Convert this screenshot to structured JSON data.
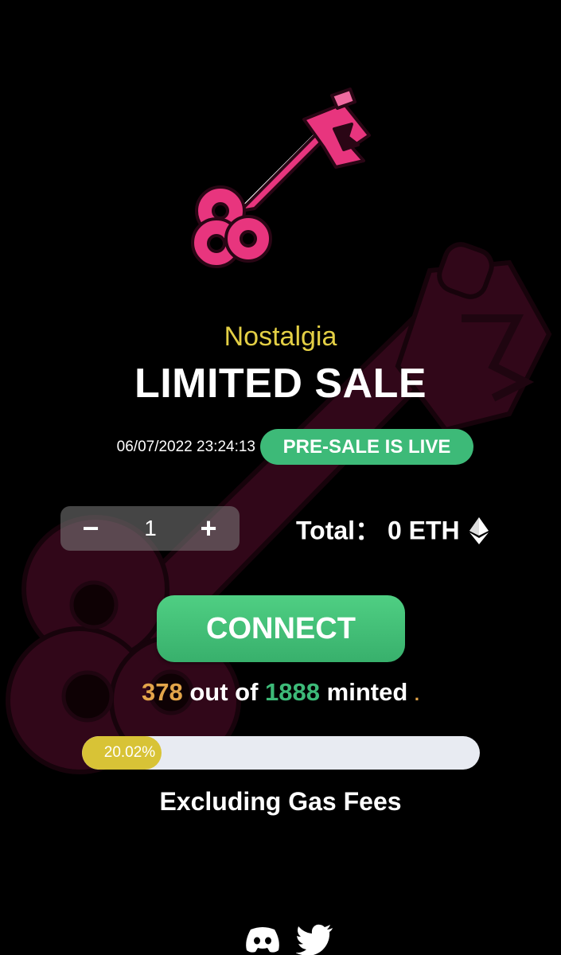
{
  "hero": {
    "collection_name": "Nostalgia",
    "sale_title": "LIMITED SALE",
    "timestamp": "06/07/2022 23:24:13",
    "status_badge": "PRE-SALE IS LIVE"
  },
  "purchase": {
    "minus_label": "−",
    "quantity": "1",
    "plus_label": "+",
    "total_label": "Total：",
    "total_value": "0 ETH",
    "currency_icon": "ethereum-icon",
    "connect_label": "CONNECT"
  },
  "mint_status": {
    "minted_count": "378",
    "out_of_text": "out of",
    "total_supply": "1888",
    "minted_text": "minted",
    "trailing_dot": ".",
    "progress_percent": 20.02,
    "progress_label": "20.02%"
  },
  "note": "Excluding Gas Fees",
  "social": {
    "icons": [
      "discord-icon",
      "twitter-icon"
    ]
  },
  "colors": {
    "background": "#000000",
    "accent_yellow": "#e3cf45",
    "accent_green": "#3dba78",
    "accent_orange": "#e3a54a",
    "key_pink": "#e8357e",
    "progress_track": "#e8ebf2",
    "progress_fill": "#d8c336"
  }
}
